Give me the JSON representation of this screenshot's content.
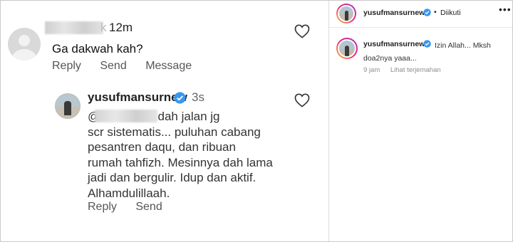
{
  "comment1": {
    "name_tail": "k",
    "time": "12m",
    "text": "Ga dakwah kah?",
    "actions": [
      "Reply",
      "Send",
      "Message"
    ]
  },
  "reply": {
    "username": "yusufmansurnew",
    "time": "3s",
    "text": "@                    k dakwah dah jalan jg\nscr sistematis... puluhan cabang\npesantren daqu, dan ribuan\nrumah tahfizh. Mesinnya dah lama\njadi dan bergulir. Idup dan aktif.\nAlhamdulillaah.",
    "actions": [
      "Reply",
      "Send"
    ]
  },
  "post_panel": {
    "username": "yusufmansurnew",
    "separator": "•",
    "follow_status": "Diikuti",
    "more": "•••",
    "comment": {
      "username": "yusufmansurnew",
      "text": "Izin Allah... Mksh doa2nya yaaa...",
      "time": "9 jam",
      "translate": "Lihat terjemahan"
    }
  },
  "colors": {
    "verified": "#3897f0",
    "story_ring": "#ee2a7b"
  }
}
